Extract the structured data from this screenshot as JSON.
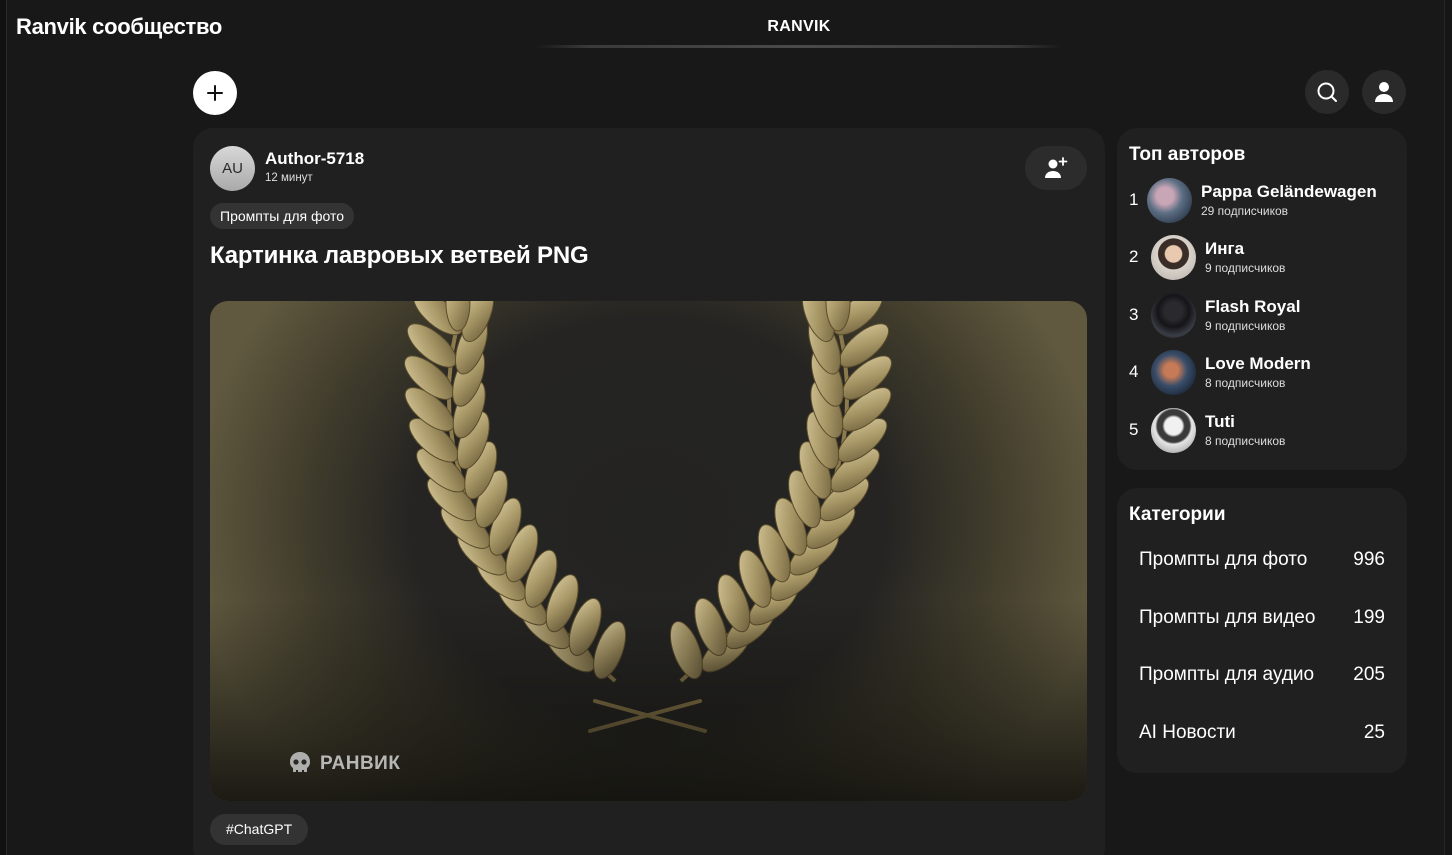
{
  "header": {
    "app_title": "Ranvik сообщество",
    "brand": "RANVIK"
  },
  "icons": {
    "add": "plus-icon",
    "search": "search-icon",
    "profile": "user-icon",
    "follow": "user-plus-icon"
  },
  "post": {
    "author_initials": "AU",
    "author_name": "Author-5718",
    "time": "12 минут",
    "category": "Промпты для фото",
    "title": "Картинка лавровых ветвей PNG",
    "image_alt": "laurel-wreath-image",
    "watermark": "РАНВИК",
    "hashtag": "#ChatGPT"
  },
  "top_authors": {
    "title": "Топ авторов",
    "items": [
      {
        "rank": "1",
        "name": "Pappa Geländewagen",
        "subs": "29 подписчиков"
      },
      {
        "rank": "2",
        "name": "Инга",
        "subs": "9 подписчиков"
      },
      {
        "rank": "3",
        "name": "Flash Royal",
        "subs": "9 подписчиков"
      },
      {
        "rank": "4",
        "name": "Love Modern",
        "subs": "8 подписчиков"
      },
      {
        "rank": "5",
        "name": "Tuti",
        "subs": "8 подписчиков"
      }
    ]
  },
  "categories": {
    "title": "Категории",
    "items": [
      {
        "label": "Промпты для фото",
        "count": "996"
      },
      {
        "label": "Промпты для видео",
        "count": "199"
      },
      {
        "label": "Промпты для аудио",
        "count": "205"
      },
      {
        "label": "AI Новости",
        "count": "25"
      }
    ]
  },
  "colors": {
    "background": "#181818",
    "card": "#202020",
    "chip": "#333333",
    "gold": "#b9a574"
  }
}
